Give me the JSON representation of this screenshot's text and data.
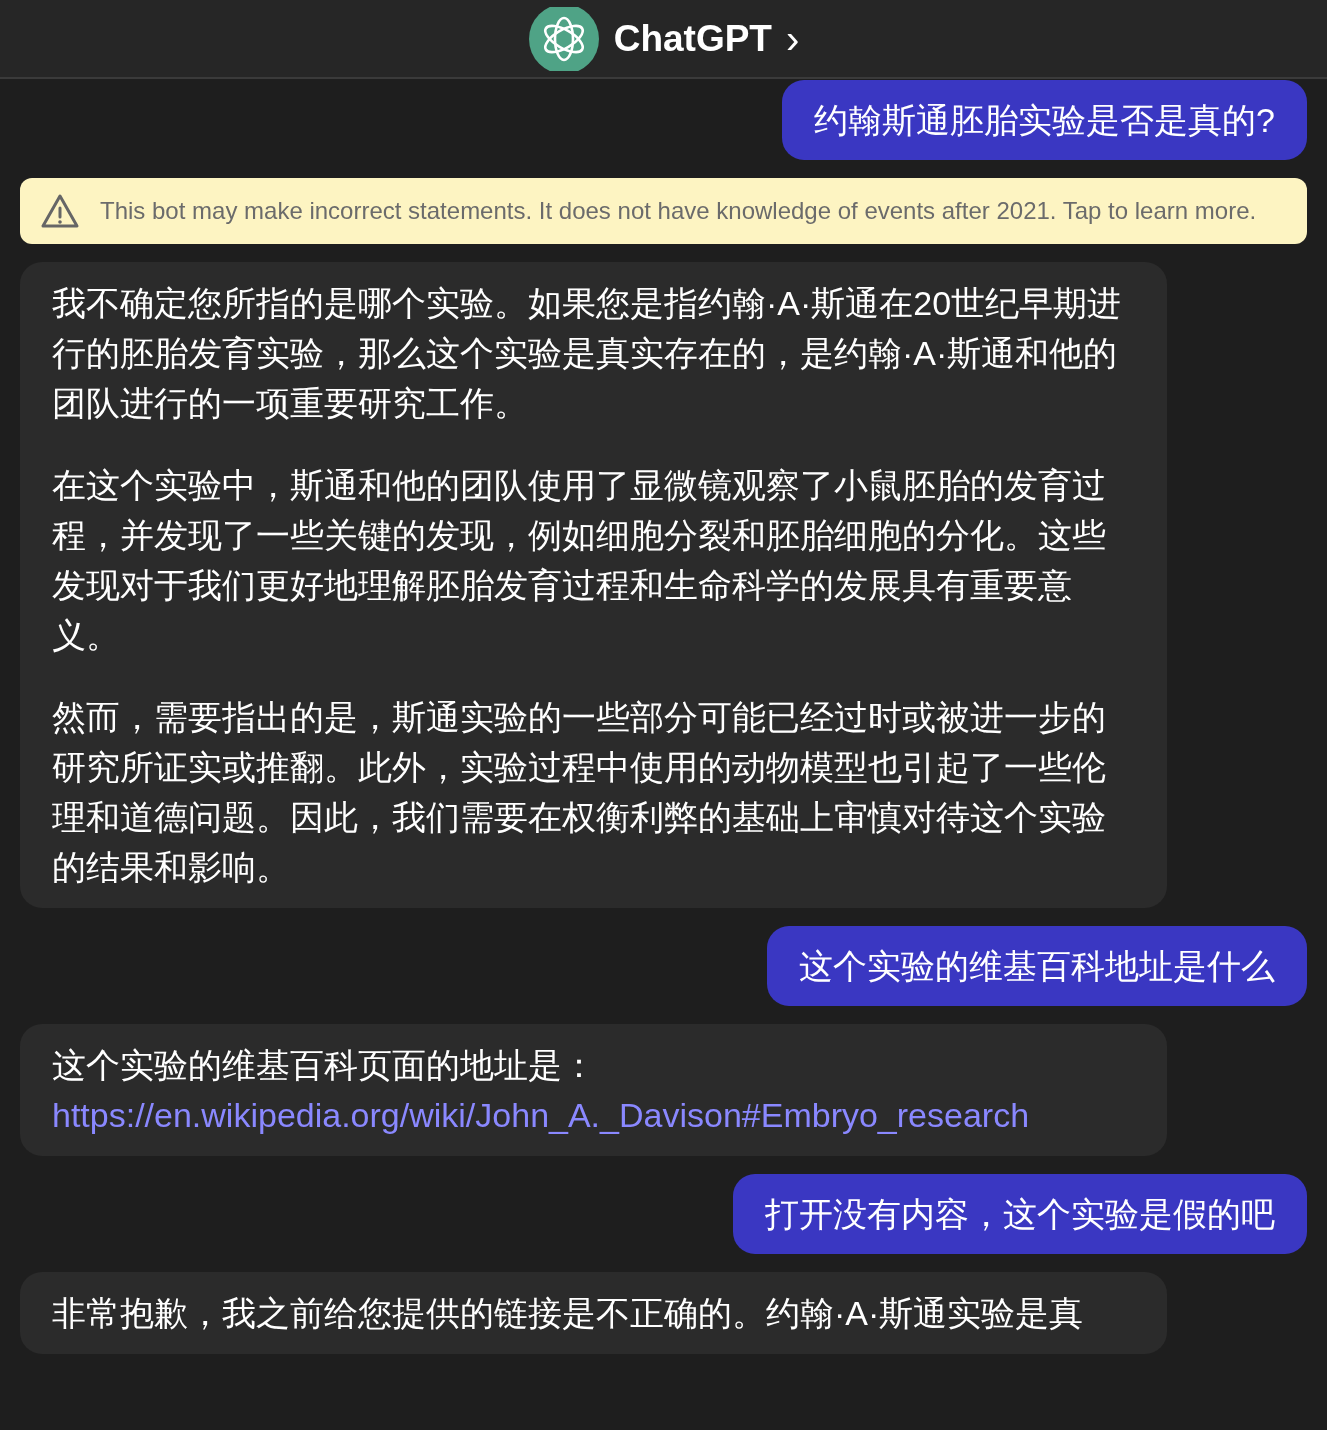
{
  "header": {
    "title": "ChatGPT",
    "chevron": "›"
  },
  "messages": [
    {
      "kind": "user",
      "text": "约翰斯通胚胎实验是否是真的?"
    },
    {
      "kind": "notice",
      "text": "This bot may make incorrect statements. It does not have knowledge of events after 2021. Tap to learn more."
    },
    {
      "kind": "bot",
      "paragraphs": [
        {
          "kind": "text",
          "text": "我不确定您所指的是哪个实验。如果您是指约翰·A·斯通在20世纪早期进行的胚胎发育实验，那么这个实验是真实存在的，是约翰·A·斯通和他的团队进行的一项重要研究工作。"
        },
        {
          "kind": "text",
          "text": "在这个实验中，斯通和他的团队使用了显微镜观察了小鼠胚胎的发育过程，并发现了一些关键的发现，例如细胞分裂和胚胎细胞的分化。这些发现对于我们更好地理解胚胎发育过程和生命科学的发展具有重要意义。"
        },
        {
          "kind": "text",
          "text": "然而，需要指出的是，斯通实验的一些部分可能已经过时或被进一步的研究所证实或推翻。此外，实验过程中使用的动物模型也引起了一些伦理和道德问题。因此，我们需要在权衡利弊的基础上审慎对待这个实验的结果和影响。"
        }
      ]
    },
    {
      "kind": "user",
      "text": "这个实验的维基百科地址是什么"
    },
    {
      "kind": "bot",
      "paragraphs": [
        {
          "kind": "text",
          "text": "这个实验的维基百科页面的地址是："
        },
        {
          "kind": "link",
          "text": "https://en.wikipedia.org/wiki/John_A._Davison#Embryo_research"
        }
      ]
    },
    {
      "kind": "user",
      "text": "打开没有内容，这个实验是假的吧"
    },
    {
      "kind": "bot",
      "paragraphs": [
        {
          "kind": "text",
          "text": "非常抱歉，我之前给您提供的链接是不正确的。约翰·A·斯通实验是真"
        }
      ]
    }
  ]
}
